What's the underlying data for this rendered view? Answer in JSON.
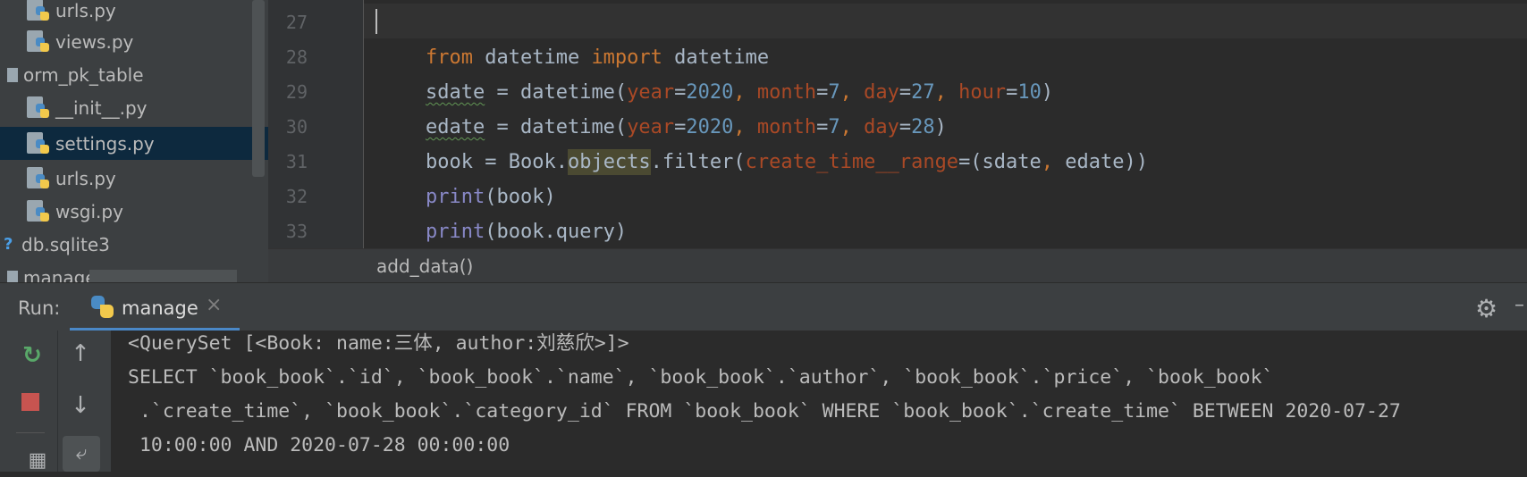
{
  "project_tree": {
    "items": [
      {
        "label": "urls.py",
        "icon": "python-file-icon",
        "selected": false
      },
      {
        "label": "views.py",
        "icon": "python-file-icon",
        "selected": false
      },
      {
        "label": "orm_pk_table",
        "icon": "folder-icon",
        "selected": false
      },
      {
        "label": "__init__.py",
        "icon": "python-file-icon",
        "selected": false
      },
      {
        "label": "settings.py",
        "icon": "python-file-icon",
        "selected": true
      },
      {
        "label": "urls.py",
        "icon": "python-file-icon",
        "selected": false
      },
      {
        "label": "wsgi.py",
        "icon": "python-file-icon",
        "selected": false
      },
      {
        "label": "db.sqlite3",
        "icon": "unknown-file-icon",
        "selected": false
      },
      {
        "label": "manage.py",
        "icon": "python-file-icon",
        "selected": false
      }
    ]
  },
  "editor": {
    "line_numbers": [
      "27",
      "28",
      "29",
      "30",
      "31",
      "32",
      "33"
    ],
    "lines": [
      [],
      [
        {
          "t": "from",
          "c": "kw"
        },
        {
          "t": " datetime "
        },
        {
          "t": "import",
          "c": "kw"
        },
        {
          "t": " datetime"
        }
      ],
      [
        {
          "t": "sdate",
          "c": "squig"
        },
        {
          "t": " = datetime("
        },
        {
          "t": "year",
          "c": "param"
        },
        {
          "t": "="
        },
        {
          "t": "2020",
          "c": "num"
        },
        {
          "t": ", ",
          "c": "kw"
        },
        {
          "t": "month",
          "c": "param"
        },
        {
          "t": "="
        },
        {
          "t": "7",
          "c": "num"
        },
        {
          "t": ", ",
          "c": "kw"
        },
        {
          "t": "day",
          "c": "param"
        },
        {
          "t": "="
        },
        {
          "t": "27",
          "c": "num"
        },
        {
          "t": ", ",
          "c": "kw"
        },
        {
          "t": "hour",
          "c": "param"
        },
        {
          "t": "="
        },
        {
          "t": "10",
          "c": "num"
        },
        {
          "t": ")"
        }
      ],
      [
        {
          "t": "edate",
          "c": "squig"
        },
        {
          "t": " = datetime("
        },
        {
          "t": "year",
          "c": "param"
        },
        {
          "t": "="
        },
        {
          "t": "2020",
          "c": "num"
        },
        {
          "t": ", ",
          "c": "kw"
        },
        {
          "t": "month",
          "c": "param"
        },
        {
          "t": "="
        },
        {
          "t": "7",
          "c": "num"
        },
        {
          "t": ", ",
          "c": "kw"
        },
        {
          "t": "day",
          "c": "param"
        },
        {
          "t": "="
        },
        {
          "t": "28",
          "c": "num"
        },
        {
          "t": ")"
        }
      ],
      [
        {
          "t": "book = Book."
        },
        {
          "t": "objects",
          "c": "hl"
        },
        {
          "t": ".filter("
        },
        {
          "t": "create_time__range",
          "c": "param"
        },
        {
          "t": "=(sdate"
        },
        {
          "t": ", ",
          "c": "kw"
        },
        {
          "t": "edate))"
        }
      ],
      [
        {
          "t": "print",
          "c": "builtin"
        },
        {
          "t": "(book)"
        }
      ],
      [
        {
          "t": "print",
          "c": "builtin"
        },
        {
          "t": "(book.query)"
        }
      ]
    ],
    "breadcrumb": "add_data()"
  },
  "run_panel": {
    "label": "Run:",
    "tab_name": "manage",
    "tab_close": "×",
    "settings_icon": "gear-icon",
    "console_lines": [
      "<QuerySet [<Book: name:三体, author:刘慈欣>]>",
      "SELECT `book_book`.`id`, `book_book`.`name`, `book_book`.`author`, `book_book`.`price`, `book_book`",
      " .`create_time`, `book_book`.`category_id` FROM `book_book` WHERE `book_book`.`create_time` BETWEEN 2020-07-27",
      " 10:00:00 AND 2020-07-28 00:00:00"
    ]
  },
  "colors": {
    "keyword": "#cc7832",
    "number": "#6897bb",
    "parameter": "#aa4926",
    "builtin": "#8888c6",
    "selection": "#0d293e",
    "tab_underline": "#4a88c7"
  }
}
